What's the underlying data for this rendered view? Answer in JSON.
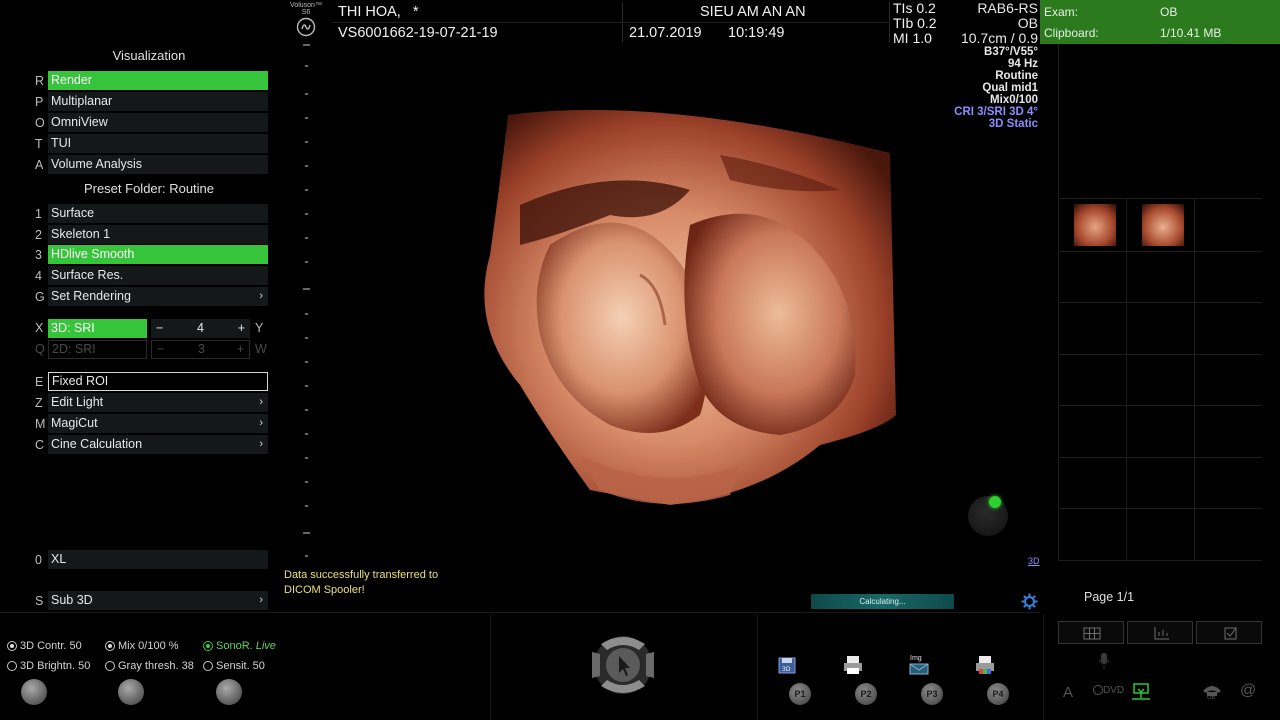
{
  "brand": {
    "name": "Voluson™",
    "model": "S6"
  },
  "header": {
    "patient": "THI HOA,",
    "asterisk": "*",
    "exam_id": "VS6001662-19-07-21-19",
    "institution": "SIEU AM AN AN",
    "date": "21.07.2019",
    "time": "10:19:49"
  },
  "indices": {
    "tis_label": "TIs",
    "tis": "0.2",
    "tib_label": "TIb",
    "tib": "0.2",
    "mi_label": "MI",
    "mi": "1.0"
  },
  "probe": {
    "name": "RAB6-RS",
    "app": "OB",
    "depth": "10.7cm / 0.9",
    "angles": "B37°/V55°",
    "freq": "94 Hz",
    "preset": "Routine",
    "quality": "Qual mid1",
    "mix": "Mix0/100",
    "cri": "CRI 3/SRI 3D 4°",
    "mode": "3D Static",
    "mode_color": "#8f8cff"
  },
  "exam_panel": {
    "exam_label": "Exam:",
    "exam_value": "OB",
    "clipboard_label": "Clipboard:",
    "clipboard_value": "1/10.41 MB",
    "bg_color": "#2c7a1e"
  },
  "menu": {
    "visualization_title": "Visualization",
    "visualization": [
      {
        "key": "R",
        "label": "Render",
        "active": true
      },
      {
        "key": "P",
        "label": "Multiplanar"
      },
      {
        "key": "O",
        "label": "OmniView"
      },
      {
        "key": "T",
        "label": "TUI"
      },
      {
        "key": "A",
        "label": "Volume Analysis"
      }
    ],
    "preset_title": "Preset Folder: Routine",
    "presets": [
      {
        "key": "1",
        "label": "Surface"
      },
      {
        "key": "2",
        "label": "Skeleton 1"
      },
      {
        "key": "3",
        "label": "HDlive Smooth",
        "active": true
      },
      {
        "key": "4",
        "label": "Surface Res."
      },
      {
        "key": "G",
        "label": "Set Rendering",
        "chevron": "›"
      }
    ],
    "sri3d": {
      "key": "X",
      "label": "3D: SRI",
      "minus": "−",
      "value": "4",
      "plus": "+",
      "right_key": "Y"
    },
    "sri2d": {
      "key": "Q",
      "label": "2D: SRI",
      "minus": "−",
      "value": "3",
      "plus": "+",
      "right_key": "W"
    },
    "tools": [
      {
        "key": "E",
        "label": "Fixed ROI"
      },
      {
        "key": "Z",
        "label": "Edit Light",
        "chevron": "›"
      },
      {
        "key": "M",
        "label": "MagiCut",
        "chevron": "›"
      },
      {
        "key": "C",
        "label": "Cine Calculation",
        "chevron": "›"
      }
    ],
    "xl": {
      "key": "0",
      "label": "XL"
    },
    "sub3d": {
      "key": "S",
      "label": "Sub 3D",
      "chevron": "›"
    },
    "active_color": "#35c43a"
  },
  "status": {
    "message_line1": "Data successfully transferred to",
    "message_line2": "DICOM Spooler!",
    "message_color": "#e8e07a",
    "calculating": "Calculating...",
    "mode_tag": "3D"
  },
  "clipboard": {
    "page": "Page 1/1"
  },
  "bottom": {
    "contr": "3D Contr. 50",
    "mix": "Mix 0/100 %",
    "sonor": "SonoR.",
    "sonor_live": "Live",
    "brightn": "3D Brightn. 50",
    "gray": "Gray thresh. 38",
    "sensit": "Sensit. 50",
    "p1": "P1",
    "p2": "P2",
    "p3": "P3",
    "p4": "P4",
    "img_label": "Img",
    "dvd": "DVD",
    "font_a": "A",
    "at": "@",
    "ge": "GE"
  }
}
